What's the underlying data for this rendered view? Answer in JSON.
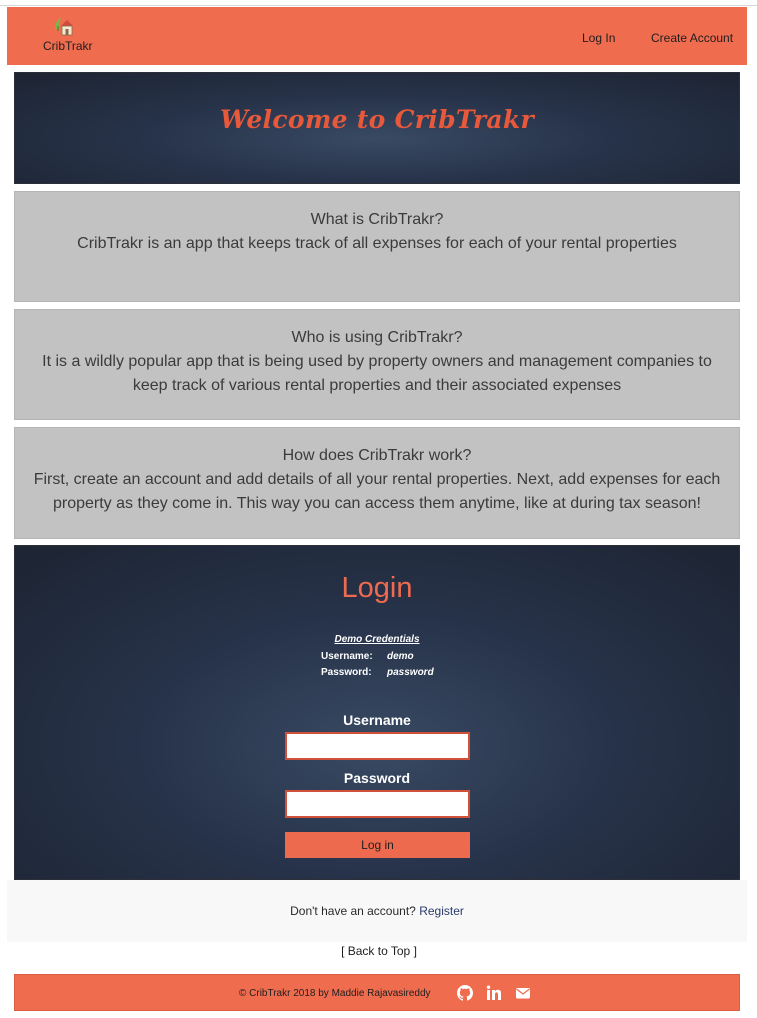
{
  "navbar": {
    "brand": "CribTrakr",
    "links": [
      "Log In",
      "Create Account"
    ]
  },
  "hero": {
    "title": "Welcome to CribTrakr"
  },
  "info": [
    {
      "heading": "What is CribTrakr?",
      "text": "CribTrakr is an app that keeps track of all expenses for each of your rental properties"
    },
    {
      "heading": "Who is using CribTrakr?",
      "text": "It is a wildly popular app that is being used by property owners and management companies to keep track of various rental properties and their associated expenses"
    },
    {
      "heading": "How does CribTrakr work?",
      "text": "First, create an account and add details of all your rental properties. Next, add expenses for each property as they come in. This way you can access them anytime, like at during tax season!"
    }
  ],
  "login": {
    "title": "Login",
    "demo_title": "Demo Credentials",
    "demo_username_label": "Username:",
    "demo_username": "demo",
    "demo_password_label": "Password:",
    "demo_password": "password",
    "username_label": "Username",
    "password_label": "Password",
    "username_value": "",
    "password_value": "",
    "button": "Log in"
  },
  "register": {
    "prompt": "Don't have an account?",
    "link": "Register"
  },
  "back_to_top": "[ Back to Top ]",
  "footer": {
    "copyright": "© CribTrakr 2018 by Maddie Rajavasireddy",
    "icons": [
      "github-icon",
      "linkedin-icon",
      "envelope-icon"
    ]
  },
  "colors": {
    "accent": "#f06c4f",
    "dark_bg": "#27334a",
    "info_bg": "#c2c2c2",
    "title_orange": "#e8583b"
  }
}
